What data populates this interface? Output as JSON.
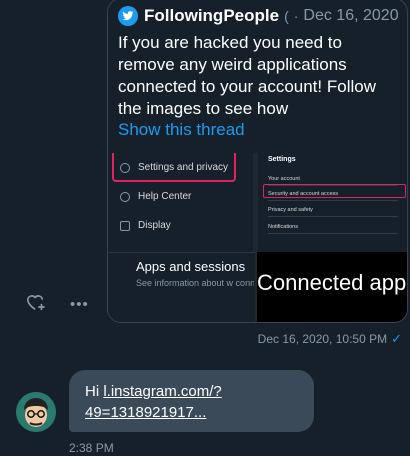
{
  "tweet": {
    "author": "FollowingPeople",
    "handle_fragment": "(",
    "separator": "·",
    "date": "Dec 16, 2020",
    "text": "If you are hacked you need to remove any weird applications connected to your account! Follow the images to see how",
    "show_thread": "Show this thread"
  },
  "media": {
    "left_menu": [
      "Settings and privacy",
      "Help Center",
      "Display"
    ],
    "settings_title": "Settings",
    "settings_items": [
      "Your account",
      "Security and account access",
      "Privacy and safety",
      "Notifications"
    ],
    "apps_title": "Apps and sessions",
    "apps_desc": "See information about w connected to your accou",
    "connected": "Connected app"
  },
  "message_meta": {
    "timestamp": "Dec 16, 2020, 10:50 PM",
    "status_icon": "checkmark-icon"
  },
  "reply": {
    "prefix": "Hi ",
    "link": "l.instagram.com/?49=1318921917...",
    "time": "2:38 PM"
  },
  "colors": {
    "background": "#15202b",
    "accent": "#1d9bf0",
    "highlight": "#e0245e",
    "bubble": "#3a4a58"
  }
}
